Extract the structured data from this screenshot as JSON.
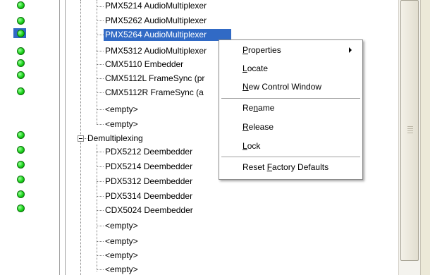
{
  "tree": {
    "nodes": [
      {
        "label": "PMX5214 AudioMultiplexer",
        "status": "green"
      },
      {
        "label": "PMX5262 AudioMultiplexer",
        "status": "green"
      },
      {
        "label": "PMX5264 AudioMultiplexer",
        "status": "green",
        "selected": true
      },
      {
        "label": "PMX5312 AudioMultiplexer",
        "status": "green"
      },
      {
        "label": "CMX5110 Embedder",
        "status": "green"
      },
      {
        "label": "CMX5112L FrameSync (pr",
        "status": "green"
      },
      {
        "label": "CMX5112R FrameSync (a",
        "status": "green"
      },
      {
        "label": "<empty>"
      },
      {
        "label": "<empty>"
      },
      {
        "label": "Demultiplexing",
        "status": "green",
        "group": true
      },
      {
        "label": "PDX5212 Deembedder",
        "status": "green"
      },
      {
        "label": "PDX5214 Deembedder",
        "status": "green"
      },
      {
        "label": "PDX5312 Deembedder",
        "status": "green"
      },
      {
        "label": "PDX5314 Deembedder",
        "status": "green"
      },
      {
        "label": "CDX5024 Deembedder",
        "status": "green"
      },
      {
        "label": "<empty>"
      },
      {
        "label": "<empty>"
      },
      {
        "label": "<empty>"
      },
      {
        "label": "<empty>"
      }
    ]
  },
  "context_menu": {
    "items": [
      {
        "pre": "",
        "key": "P",
        "post": "roperties",
        "submenu": true
      },
      {
        "pre": "",
        "key": "L",
        "post": "ocate"
      },
      {
        "pre": "",
        "key": "N",
        "post": "ew Control Window"
      },
      {
        "pre": "Re",
        "key": "n",
        "post": "ame"
      },
      {
        "pre": "",
        "key": "R",
        "post": "elease"
      },
      {
        "pre": "",
        "key": "L",
        "post": "ock"
      },
      {
        "pre": "Reset ",
        "key": "F",
        "post": "actory Defaults"
      }
    ]
  },
  "colors": {
    "status_online": "#19d419",
    "selection": "#316ac5"
  }
}
